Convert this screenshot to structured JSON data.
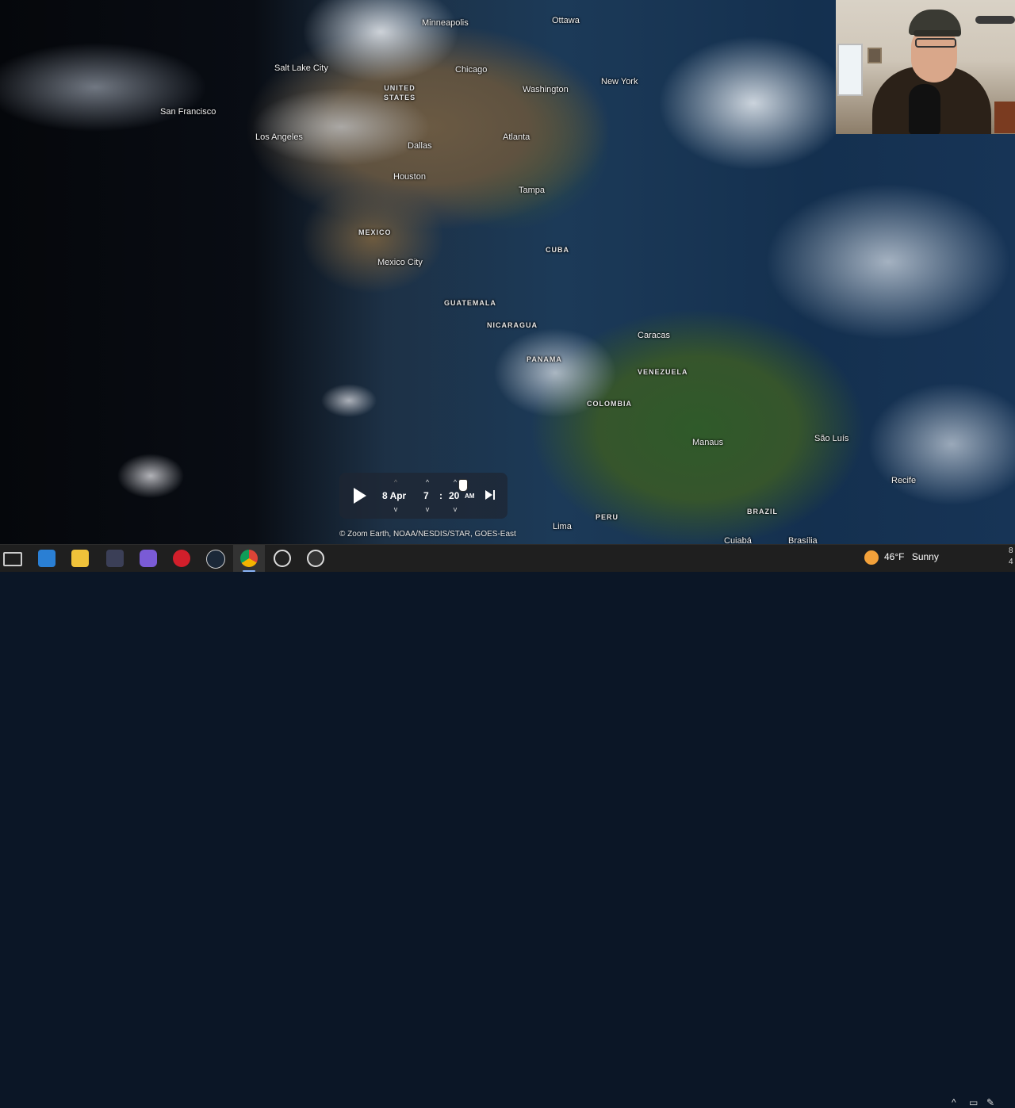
{
  "map": {
    "city_labels": [
      {
        "id": "minneapolis",
        "text": "Minneapolis"
      },
      {
        "id": "ottawa",
        "text": "Ottawa"
      },
      {
        "id": "salt-lake-city",
        "text": "Salt Lake City"
      },
      {
        "id": "chicago",
        "text": "Chicago"
      },
      {
        "id": "san-francisco",
        "text": "San Francisco"
      },
      {
        "id": "washington",
        "text": "Washington"
      },
      {
        "id": "new-york",
        "text": "New York"
      },
      {
        "id": "los-angeles",
        "text": "Los Angeles"
      },
      {
        "id": "dallas",
        "text": "Dallas"
      },
      {
        "id": "atlanta",
        "text": "Atlanta"
      },
      {
        "id": "houston",
        "text": "Houston"
      },
      {
        "id": "tampa",
        "text": "Tampa"
      },
      {
        "id": "mexico-city",
        "text": "Mexico City"
      },
      {
        "id": "caracas",
        "text": "Caracas"
      },
      {
        "id": "manaus",
        "text": "Manaus"
      },
      {
        "id": "sao-luis",
        "text": "São Luís"
      },
      {
        "id": "recife",
        "text": "Recife"
      },
      {
        "id": "lima",
        "text": "Lima"
      },
      {
        "id": "cuiaba",
        "text": "Cuiabá"
      },
      {
        "id": "brasilia",
        "text": "Brasília"
      }
    ],
    "country_labels": [
      {
        "id": "united-states",
        "text": "UNITED STATES"
      },
      {
        "id": "mexico",
        "text": "MEXICO"
      },
      {
        "id": "cuba",
        "text": "CUBA"
      },
      {
        "id": "guatemala",
        "text": "GUATEMALA"
      },
      {
        "id": "nicaragua",
        "text": "NICARAGUA"
      },
      {
        "id": "panama",
        "text": "PANAMA"
      },
      {
        "id": "venezuela",
        "text": "VENEZUELA"
      },
      {
        "id": "colombia",
        "text": "COLOMBIA"
      },
      {
        "id": "peru",
        "text": "PERU"
      },
      {
        "id": "brazil",
        "text": "BRAZIL"
      }
    ],
    "credit": "© Zoom Earth, NOAA/NESDIS/STAR, GOES-East"
  },
  "player": {
    "play_icon": "play-icon",
    "date": "8 Apr",
    "hour": "7",
    "separator": ":",
    "minute": "20",
    "ampm": "AM",
    "skip_icon": "skip-to-end-icon"
  },
  "taskbar": {
    "icons": [
      "task-view-icon",
      "mail-icon",
      "file-explorer-icon",
      "davinci-resolve-icon",
      "affinity-icon",
      "opera-icon",
      "steam-icon",
      "chrome-icon",
      "obs-icon",
      "recorder-icon"
    ],
    "weather": {
      "temp": "46°F",
      "condition": "Sunny",
      "icon": "sun-icon"
    },
    "tray_icons": [
      "chevron-up-icon",
      "network-icon",
      "pen-icon"
    ],
    "clock_fragment_top": "8",
    "clock_fragment_bottom": "4"
  },
  "colors": {
    "taskbar_bg": "#1f1f1f",
    "player_bg": "#1e2632",
    "weather_icon": "#f3a13a",
    "chrome_indicator": "#8ab4f8"
  }
}
